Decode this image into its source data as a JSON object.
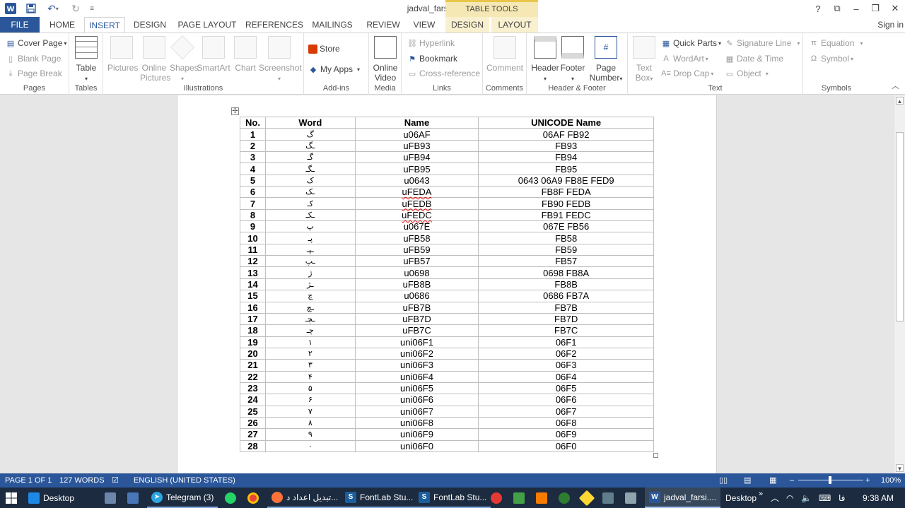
{
  "title_bar": {
    "document_title": "jadval_farsi.docx - Word",
    "context_group": "TABLE TOOLS",
    "help": "?",
    "ribbon_display": "⧉",
    "minimize": "–",
    "restore": "❐",
    "close": "✕"
  },
  "tabs": {
    "file": "FILE",
    "home": "HOME",
    "insert": "INSERT",
    "design": "DESIGN",
    "page_layout": "PAGE LAYOUT",
    "references": "REFERENCES",
    "mailings": "MAILINGS",
    "review": "REVIEW",
    "view": "VIEW",
    "table_design": "DESIGN",
    "table_layout": "LAYOUT",
    "sign_in": "Sign in"
  },
  "ribbon": {
    "pages": {
      "label": "Pages",
      "cover_page": "Cover Page",
      "blank_page": "Blank Page",
      "page_break": "Page Break"
    },
    "tables": {
      "label": "Tables",
      "table": "Table"
    },
    "illustrations": {
      "label": "Illustrations",
      "pictures": "Pictures",
      "online_pictures_1": "Online",
      "online_pictures_2": "Pictures",
      "shapes": "Shapes",
      "smartart": "SmartArt",
      "chart": "Chart",
      "screenshot": "Screenshot"
    },
    "addins": {
      "label": "Add-ins",
      "store": "Store",
      "my_apps": "My Apps"
    },
    "media": {
      "label": "Media",
      "online_video_1": "Online",
      "online_video_2": "Video"
    },
    "links": {
      "label": "Links",
      "hyperlink": "Hyperlink",
      "bookmark": "Bookmark",
      "cross_reference": "Cross-reference"
    },
    "comments": {
      "label": "Comments",
      "comment": "Comment"
    },
    "header_footer": {
      "label": "Header & Footer",
      "header": "Header",
      "footer": "Footer",
      "page_number_1": "Page",
      "page_number_2": "Number"
    },
    "text": {
      "label": "Text",
      "text_box_1": "Text",
      "text_box_2": "Box",
      "quick_parts": "Quick Parts",
      "wordart": "WordArt",
      "drop_cap": "Drop Cap",
      "signature_line": "Signature Line",
      "date_time": "Date & Time",
      "object": "Object"
    },
    "symbols": {
      "label": "Symbols",
      "equation": "Equation",
      "symbol": "Symbol"
    }
  },
  "table": {
    "headers": [
      "No.",
      "Word",
      "Name",
      "UNICODE Name"
    ],
    "rows": [
      [
        "1",
        "گ",
        "u06AF",
        "06AF FB92"
      ],
      [
        "2",
        "ـگ",
        "uFB93",
        "FB93"
      ],
      [
        "3",
        "گـ",
        "uFB94",
        "FB94"
      ],
      [
        "4",
        "ـگـ",
        "uFB95",
        "FB95"
      ],
      [
        "5",
        "ک",
        "u0643",
        "0643 06A9 FB8E FED9"
      ],
      [
        "6",
        "ـک",
        "uFEDA",
        "FB8F FEDA"
      ],
      [
        "7",
        "کـ",
        "uFEDB",
        "FB90 FEDB"
      ],
      [
        "8",
        "ـکـ",
        "uFEDC",
        "FB91 FEDC"
      ],
      [
        "9",
        "پ",
        "u067E",
        "067E FB56"
      ],
      [
        "10",
        "پـ",
        "uFB58",
        "FB58"
      ],
      [
        "11",
        "ـپـ",
        "uFB59",
        "FB59"
      ],
      [
        "12",
        "ـپ",
        "uFB57",
        "FB57"
      ],
      [
        "13",
        "ژ",
        "u0698",
        "0698 FB8A"
      ],
      [
        "14",
        "ـژ",
        "uFB8B",
        "FB8B"
      ],
      [
        "15",
        "چ",
        "u0686",
        "0686 FB7A"
      ],
      [
        "16",
        "ـچ",
        "uFB7B",
        "FB7B"
      ],
      [
        "17",
        "ـچـ",
        "uFB7D",
        "FB7D"
      ],
      [
        "18",
        "چـ",
        "uFB7C",
        "FB7C"
      ],
      [
        "19",
        "۱",
        "uni06F1",
        "06F1"
      ],
      [
        "20",
        "۲",
        "uni06F2",
        "06F2"
      ],
      [
        "21",
        "۳",
        "uni06F3",
        "06F3"
      ],
      [
        "22",
        "۴",
        "uni06F4",
        "06F4"
      ],
      [
        "23",
        "۵",
        "uni06F5",
        "06F5"
      ],
      [
        "24",
        "۶",
        "uni06F6",
        "06F6"
      ],
      [
        "25",
        "۷",
        "uni06F7",
        "06F7"
      ],
      [
        "26",
        "۸",
        "uni06F8",
        "06F8"
      ],
      [
        "27",
        "۹",
        "uni06F9",
        "06F9"
      ],
      [
        "28",
        "۰",
        "uni06F0",
        "06F0"
      ]
    ],
    "spellcheck_flagged": [
      "uFEDA",
      "uFEDB",
      "uFEDC"
    ]
  },
  "status_bar": {
    "page": "PAGE 1 OF 1",
    "words": "127 WORDS",
    "language": "ENGLISH (UNITED STATES)",
    "zoom": "100%",
    "zoom_minus": "–",
    "zoom_plus": "+"
  },
  "taskbar": {
    "desktop": "Desktop",
    "telegram": "Telegram (3)",
    "firefox_window": "تبدیل اعداد د...",
    "fontlab_1": "FontLab Stu...",
    "fontlab_2": "FontLab Stu...",
    "word": "jadval_farsi....",
    "desktop_toolbar": "Desktop",
    "language": "فا",
    "time": "9:38 AM"
  },
  "colors": {
    "accent": "#2b579a",
    "taskbar": "#1c2b3f",
    "context_tab": "#f5e8b4",
    "page_bg": "#ffffff",
    "canvas_bg": "#e6e6e6"
  },
  "icons": [
    "word-app-icon",
    "save-icon",
    "undo-icon",
    "redo-icon",
    "windows-start-icon",
    "search-icon",
    "chrome-icon",
    "firefox-icon",
    "whatsapp-icon",
    "network-icon",
    "volume-icon",
    "keyboard-icon"
  ]
}
